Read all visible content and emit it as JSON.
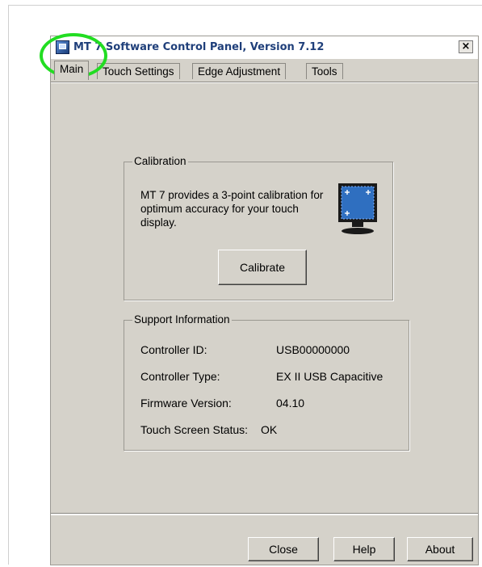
{
  "window": {
    "title": "MT 7 Software Control Panel, Version 7.12",
    "close_label": "×"
  },
  "tabs": [
    {
      "label": "Main"
    },
    {
      "label": "Touch Settings"
    },
    {
      "label": "Edge Adjustment"
    },
    {
      "label": "Tools"
    }
  ],
  "calibration": {
    "legend": "Calibration",
    "description": "MT 7 provides a 3-point calibration for optimum accuracy for your touch display.",
    "button": "Calibrate"
  },
  "support": {
    "legend": "Support Information",
    "rows": [
      {
        "label": "Controller ID:",
        "value": "USB00000000"
      },
      {
        "label": "Controller Type:",
        "value": "EX II USB Capacitive"
      },
      {
        "label": "Firmware Version:",
        "value": "04.10"
      },
      {
        "label": "Touch Screen Status:",
        "value": "OK"
      }
    ]
  },
  "footer": {
    "close": "Close",
    "help": "Help",
    "about": "About"
  },
  "colors": {
    "highlight": "#22dd22",
    "title_text": "#1f3f7a",
    "panel": "#d5d2ca"
  }
}
